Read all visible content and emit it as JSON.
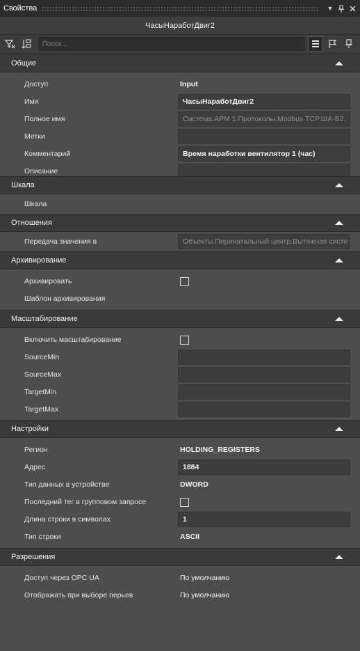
{
  "panel": {
    "title": "Свойства",
    "object_name": "ЧасыНаработДвиг2"
  },
  "toolbar": {
    "search_placeholder": "Поиск..."
  },
  "icons": {
    "filter": "filter-icon",
    "sort": "sort-icon",
    "list": "list-view-icon",
    "flag": "flag-icon",
    "pin": "pin-icon"
  },
  "sections": {
    "general": {
      "title": "Общие",
      "rows": {
        "access": {
          "label": "Доступ",
          "value": "Input"
        },
        "name": {
          "label": "Имя",
          "value": "ЧасыНаработДвиг2"
        },
        "fullname": {
          "label": "Полное имя",
          "value": "Система.АРМ 1.Протоколы.Modbus TCP.ША-В2."
        },
        "tags": {
          "label": "Метки",
          "value": ""
        },
        "comment": {
          "label": "Комментарий",
          "value": "Время наработки вентилятор 1 (час)"
        },
        "description": {
          "label": "Описание",
          "value": ""
        }
      }
    },
    "scale": {
      "title": "Шкала",
      "rows": {
        "scale": {
          "label": "Шкала"
        }
      }
    },
    "relations": {
      "title": "Отношения",
      "rows": {
        "transfer": {
          "label": "Передача значения в",
          "value": "Объекты.Перинатальный центр.Вытяжная систе"
        }
      }
    },
    "archiving": {
      "title": "Архивирование",
      "rows": {
        "archive": {
          "label": "Архивировать",
          "checked": false
        },
        "template": {
          "label": "Шаблон архивирования"
        }
      }
    },
    "scaling": {
      "title": "Масштабирование",
      "rows": {
        "enable": {
          "label": "Включить масштабирование",
          "checked": false
        },
        "source_min": {
          "label": "SourceMin",
          "value": ""
        },
        "source_max": {
          "label": "SourceMax",
          "value": ""
        },
        "target_min": {
          "label": "TargetMin",
          "value": ""
        },
        "target_max": {
          "label": "TargetMax",
          "value": ""
        }
      }
    },
    "settings": {
      "title": "Настройки",
      "rows": {
        "region": {
          "label": "Регион",
          "value": "HOLDING_REGISTERS"
        },
        "address": {
          "label": "Адрес",
          "value": "1884"
        },
        "dtype": {
          "label": "Тип данных в устройстве",
          "value": "DWORD"
        },
        "last_tag": {
          "label": "Последний тег в групповом запросе",
          "checked": false
        },
        "str_len": {
          "label": "Длина строки в символах",
          "value": "1"
        },
        "str_type": {
          "label": "Тип строки",
          "value": "ASCII"
        }
      }
    },
    "permissions": {
      "title": "Разрешения",
      "rows": {
        "opc": {
          "label": "Доступ через OPC UA",
          "value": "По умолчанию"
        },
        "pens": {
          "label": "Отображать при выборе перьев",
          "value": "По умолчанию"
        }
      }
    }
  }
}
